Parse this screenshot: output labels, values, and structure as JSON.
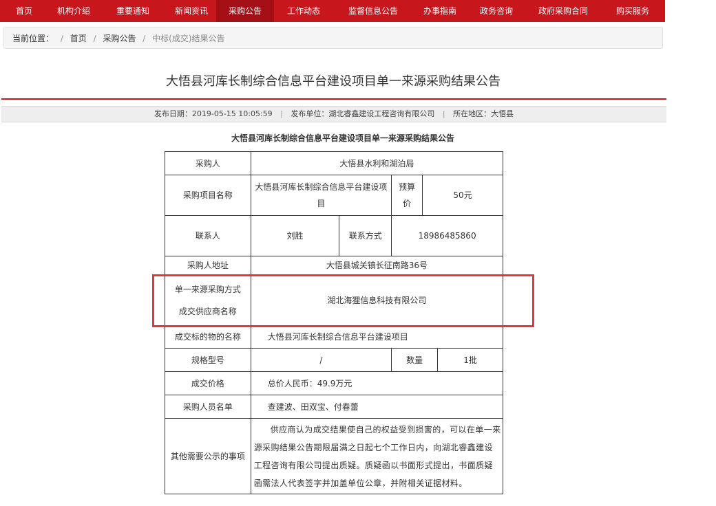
{
  "nav": {
    "items": [
      "首页",
      "机构介绍",
      "重要通知",
      "新闻资讯",
      "采购公告",
      "工作动态",
      "监督信息公告",
      "办事指南",
      "政务咨询",
      "政府采购合同",
      "购买服务"
    ],
    "active_index": 4
  },
  "breadcrumb": {
    "label": "当前位置：",
    "sep": "/",
    "home": "首页",
    "section": "采购公告",
    "current": "中标(成交)结果公告"
  },
  "article": {
    "title": "大悟县河库长制综合信息平台建设项目单一来源采购结果公告",
    "publish_date": "发布日期：2019-05-15 10:05:59",
    "publisher": "发布单位：湖北睿鑫建设工程咨询有限公司",
    "region": "所在地区：大悟县",
    "meta_sep": "|",
    "subtitle": "大悟县河库长制综合信息平台建设项目单一来源采购结果公告"
  },
  "table": {
    "purchaser_label": "采购人",
    "purchaser": "大悟县水利和湖泊局",
    "project_name_label": "采购项目名称",
    "project_name": "大悟县河库长制综合信息平台建设项目",
    "budget_label": "预算价",
    "budget": "50元",
    "contact_label": "联系人",
    "contact": "刘胜",
    "contact_method_label": "联系方式",
    "phone": "18986485860",
    "address_label": "采购人地址",
    "address": "大悟县城关镇长征南路36号",
    "method_label": "单一来源采购方式",
    "supplier_label": "成交供应商名称",
    "supplier": "湖北海狸信息科技有限公司",
    "subject_label": "成交标的物的名称",
    "subject": "大悟县河库长制综合信息平台建设项目",
    "spec_label": "规格型号",
    "spec": "/",
    "qty_label": "数量",
    "qty": "1批",
    "price_label": "成交价格",
    "price": "总价人民币：49.9万元",
    "staff_label": "采购人员名单",
    "staff": "查建波、田双宝、付春蕾",
    "other_label": "其他需要公示的事项",
    "other": "供应商认为成交结果使自己的权益受到损害的，可以在单一来源采购结果公告期限届满之日起七个工作日内，向湖北睿鑫建设工程咨询有限公司提出质疑。质疑函以书面形式提出，书面质疑函需法人代表签字并加盖单位公章，并附相关证据材料。"
  },
  "colors": {
    "brand_red": "#c8161d",
    "active_red": "#a30f14",
    "highlight_red": "#e8333b"
  }
}
